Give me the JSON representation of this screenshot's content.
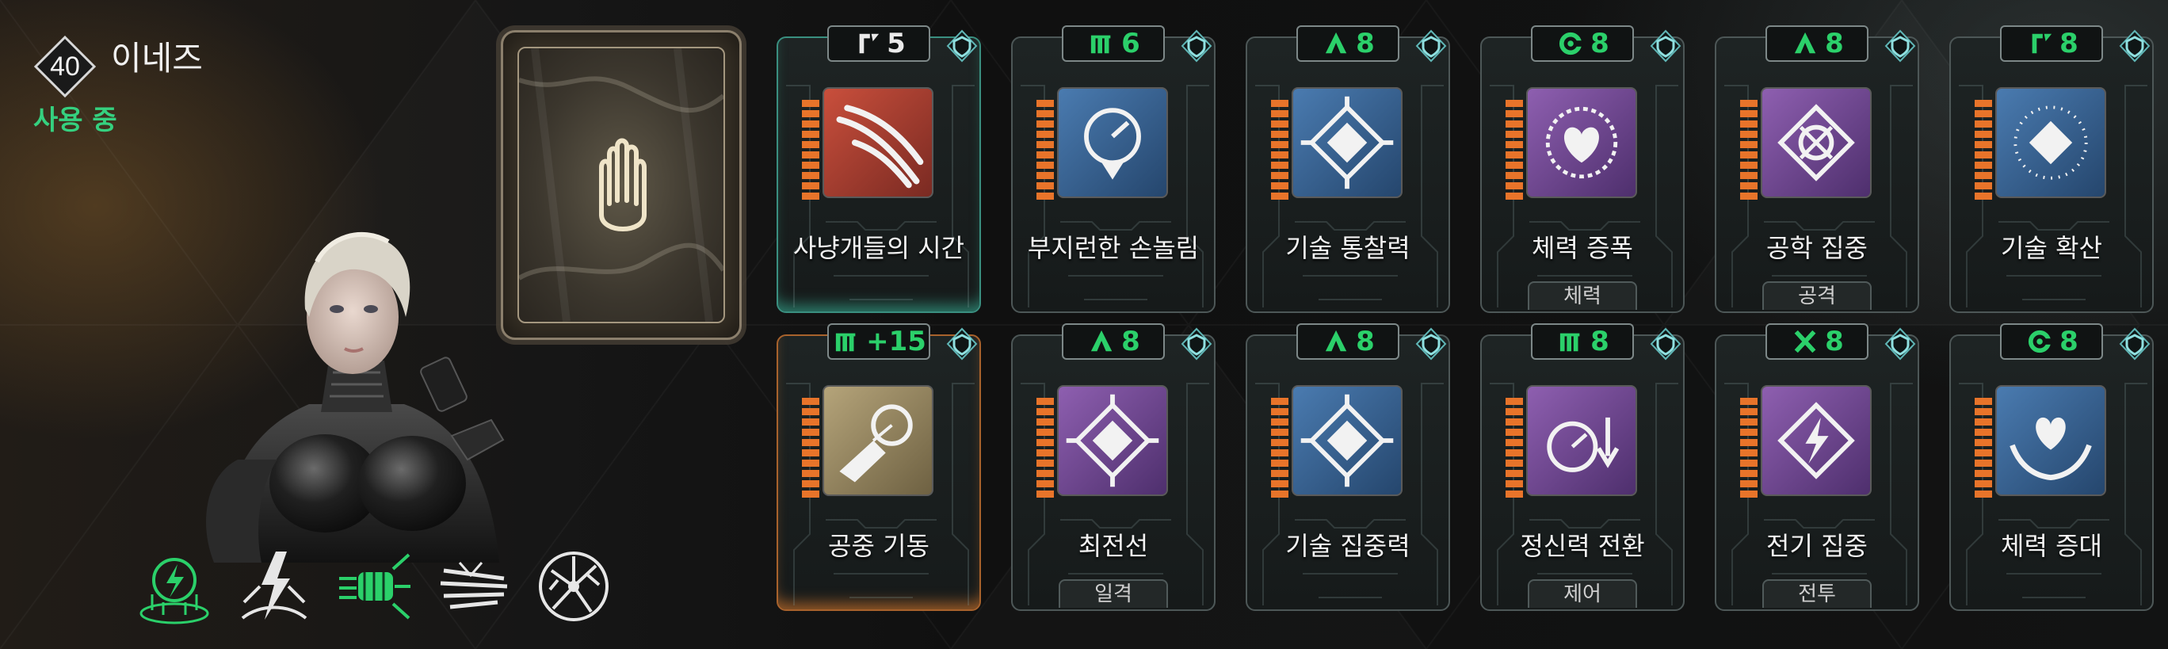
{
  "character": {
    "level": "40",
    "name": "이네즈",
    "status": "사용 중",
    "status_color": "#35d07f"
  },
  "skills": [
    {
      "icon": "lightning-field-icon",
      "active": true
    },
    {
      "icon": "lightning-strike-icon",
      "active": false
    },
    {
      "icon": "fist-charge-icon",
      "active": true
    },
    {
      "icon": "wing-blade-icon",
      "active": false
    },
    {
      "icon": "cracked-orb-icon",
      "active": false
    }
  ],
  "hand_card": {
    "icon": "hand-icon"
  },
  "cards": [
    {
      "title": "사냥개들의 시간",
      "cost_symbol": "r-bracket",
      "cost": "5",
      "cost_color": "white",
      "tag": "",
      "art": "claw-slash",
      "art_color": "red",
      "state": "teal"
    },
    {
      "title": "부지런한 손놀림",
      "cost_symbol": "m-bars",
      "cost": "6",
      "cost_color": "green",
      "tag": "",
      "art": "clock-arrow",
      "art_color": "blue",
      "state": ""
    },
    {
      "title": "기술 통찰력",
      "cost_symbol": "a-peak",
      "cost": "8",
      "cost_color": "green",
      "tag": "",
      "art": "tech-diamond",
      "art_color": "blue",
      "state": ""
    },
    {
      "title": "체력 증폭",
      "cost_symbol": "c-ring",
      "cost": "8",
      "cost_color": "green",
      "tag": "체력",
      "art": "heart-burst",
      "art_color": "purple",
      "state": ""
    },
    {
      "title": "공학 집중",
      "cost_symbol": "a-peak",
      "cost": "8",
      "cost_color": "green",
      "tag": "공격",
      "art": "gear-diamond",
      "art_color": "purple",
      "state": ""
    },
    {
      "title": "기술 확산",
      "cost_symbol": "r-bracket",
      "cost": "8",
      "cost_color": "green",
      "tag": "",
      "art": "dot-diamond",
      "art_color": "blue",
      "state": ""
    },
    {
      "title": "공중 기동",
      "cost_symbol": "m-bars",
      "cost": "+15",
      "cost_color": "green",
      "tag": "",
      "art": "grapple-hand",
      "art_color": "gold",
      "state": "orange"
    },
    {
      "title": "최전선",
      "cost_symbol": "a-peak",
      "cost": "8",
      "cost_color": "green",
      "tag": "일격",
      "art": "tech-diamond",
      "art_color": "purple",
      "state": ""
    },
    {
      "title": "기술 집중력",
      "cost_symbol": "a-peak",
      "cost": "8",
      "cost_color": "green",
      "tag": "",
      "art": "tech-diamond",
      "art_color": "blue",
      "state": ""
    },
    {
      "title": "정신력 전환",
      "cost_symbol": "m-bars",
      "cost": "8",
      "cost_color": "green",
      "tag": "제어",
      "art": "gauge-arrow",
      "art_color": "purple",
      "state": ""
    },
    {
      "title": "전기 집중",
      "cost_symbol": "x-star",
      "cost": "8",
      "cost_color": "green",
      "tag": "전투",
      "art": "bolt-diamond",
      "art_color": "purple",
      "state": ""
    },
    {
      "title": "체력 증대",
      "cost_symbol": "c-ring",
      "cost": "8",
      "cost_color": "green",
      "tag": "",
      "art": "heart-hands",
      "art_color": "blue",
      "state": ""
    }
  ],
  "colors": {
    "cost_green": "#2bd06a",
    "orange_bar": "#e8742a",
    "teal_glow": "#3ccfb0",
    "orange_glow": "#ff8c32"
  }
}
